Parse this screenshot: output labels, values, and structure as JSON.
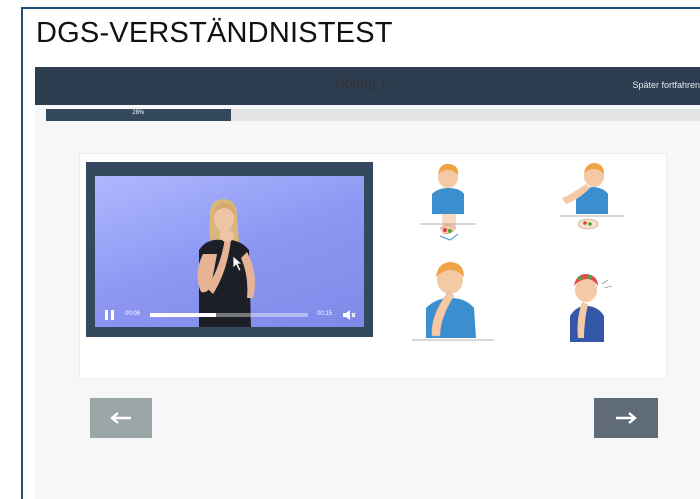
{
  "doc_title": "DGS-VERSTÄNDNISTEST",
  "topbar": {
    "later_label": "Später fortfahren"
  },
  "progress": {
    "label": "28%",
    "value": 28
  },
  "exercise": {
    "title": "Übung 1"
  },
  "video": {
    "current_time": "00:06",
    "duration": "00:15",
    "played_fraction": 0.42,
    "state": "playing"
  },
  "choices": [
    {
      "icon": "sign-chest-icon"
    },
    {
      "icon": "sign-mouth-icon"
    },
    {
      "icon": "sign-chin-icon"
    },
    {
      "icon": "sign-head-icon"
    }
  ],
  "nav": {
    "prev_icon": "arrow-left-icon",
    "next_icon": "arrow-right-icon"
  },
  "colors": {
    "topbar": "#2c3e50",
    "progress_fill": "#34495e",
    "prev_button": "#9aa6a7",
    "next_button": "#5f6b76"
  }
}
